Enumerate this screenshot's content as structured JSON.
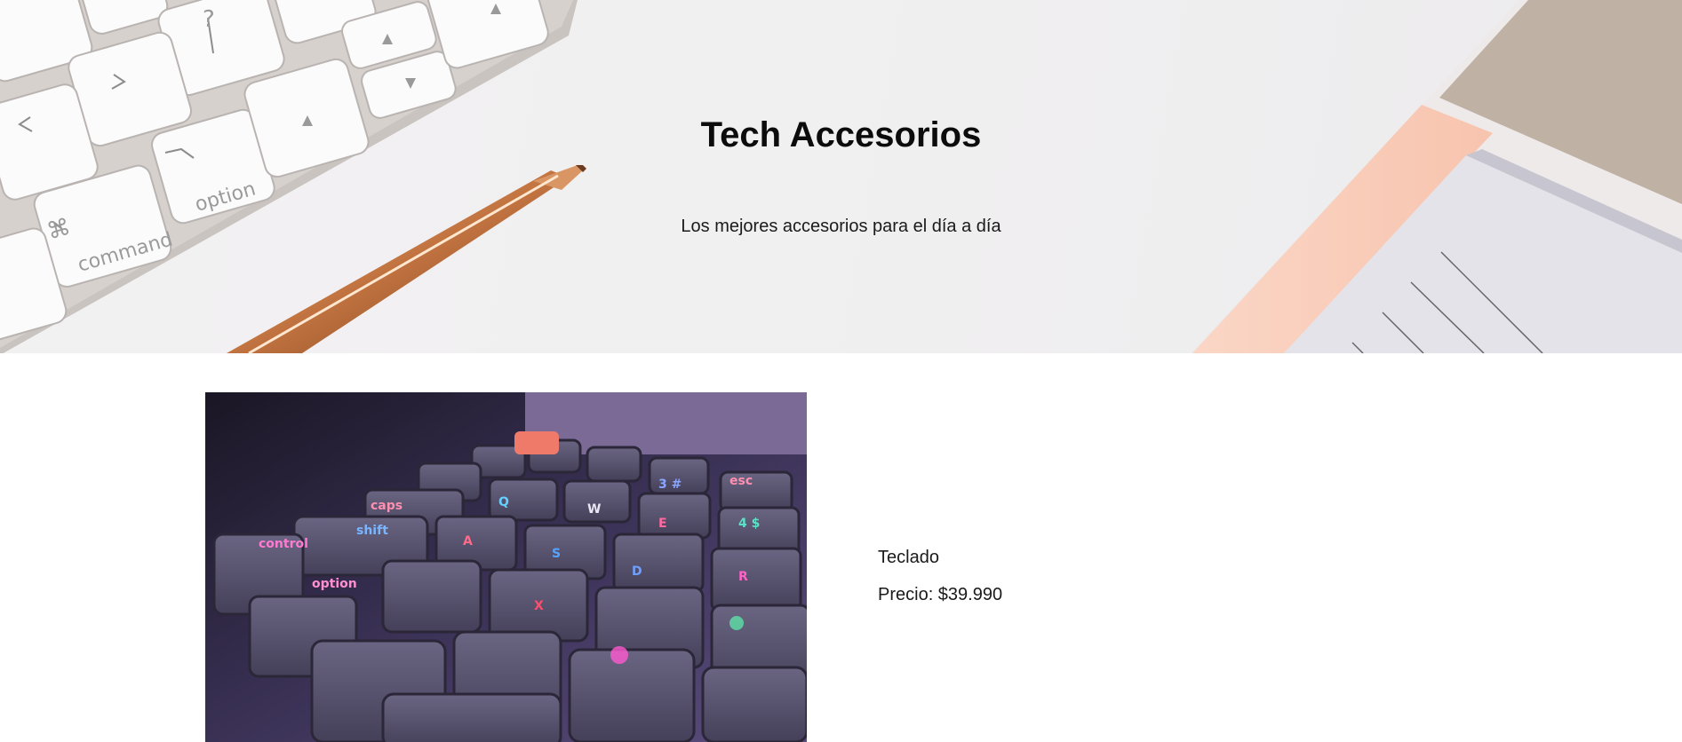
{
  "hero": {
    "title": "Tech Accesorios",
    "subtitle": "Los mejores accesorios para el día a día",
    "image": "keyboard-pen-notepad-desk-photo"
  },
  "product": {
    "name": "Teclado",
    "price": "Precio: $39.990",
    "image": "rgb-mechanical-keyboard-photo"
  },
  "colors": {
    "background": "#ffffff",
    "hero_background": "#f1f0f1",
    "text": "#111111"
  }
}
